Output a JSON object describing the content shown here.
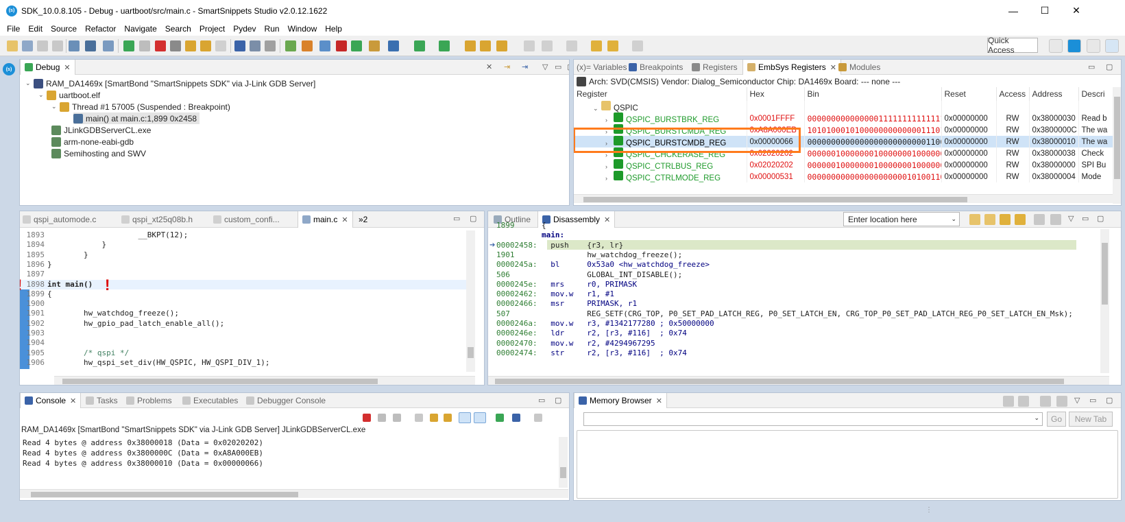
{
  "window": {
    "title": "SDK_10.0.8.105 - Debug - uartboot/src/main.c - SmartSnippets Studio v2.0.12.1622",
    "app_icon": "(s)",
    "minimize": "—",
    "maximize": "☐",
    "close": "✕"
  },
  "menu": [
    "File",
    "Edit",
    "Source",
    "Refactor",
    "Navigate",
    "Search",
    "Project",
    "Pydev",
    "Run",
    "Window",
    "Help"
  ],
  "toolbar": {
    "quick_access": "Quick Access"
  },
  "debug_view": {
    "tab": "Debug",
    "items": [
      {
        "label": "RAM_DA1469x [SmartBond \"SmartSnippets SDK\" via J-Link GDB Server]",
        "icon": "launch-icon",
        "depth": 0,
        "expanded": "⌄"
      },
      {
        "label": "uartboot.elf",
        "icon": "elf-icon",
        "depth": 1,
        "expanded": "⌄"
      },
      {
        "label": "Thread #1 57005 (Suspended : Breakpoint)",
        "icon": "thread-icon",
        "depth": 2,
        "expanded": "⌄"
      },
      {
        "label": "main() at main.c:1,899 0x2458",
        "icon": "stack-frame-icon",
        "depth": 3,
        "expanded": ""
      },
      {
        "label": "JLinkGDBServerCL.exe",
        "icon": "process-icon",
        "depth": 1,
        "expanded": ""
      },
      {
        "label": "arm-none-eabi-gdb",
        "icon": "process-icon",
        "depth": 1,
        "expanded": ""
      },
      {
        "label": "Semihosting and SWV",
        "icon": "process-icon",
        "depth": 1,
        "expanded": ""
      }
    ]
  },
  "registers_view": {
    "tabs": [
      {
        "label": "(x)= Variables",
        "active": false
      },
      {
        "label": "Breakpoints",
        "active": false
      },
      {
        "label": "Registers",
        "active": false
      },
      {
        "label": "EmbSys Registers",
        "active": true
      },
      {
        "label": "Modules",
        "active": false
      }
    ],
    "info": "Arch: SVD(CMSIS)  Vendor: Dialog_Semiconductor  Chip: DA1469x  Board: ---  none ---",
    "columns": [
      "Register",
      "Hex",
      "Bin",
      "Reset",
      "Access",
      "Address",
      "Descri"
    ],
    "group": "QSPIC",
    "rows": [
      {
        "name": "QSPIC_BURSTBRK_REG",
        "hex": "0x0001FFFF",
        "bin": "00000000000000011111111111111111",
        "reset": "0x00000000",
        "access": "RW",
        "address": "0x38000030",
        "desc": "Read b"
      },
      {
        "name": "QSPIC_BURSTCMDA_REG",
        "hex": "0xA8A000EB",
        "bin": "10101000101000000000000011101011",
        "reset": "0x00000000",
        "access": "RW",
        "address": "0x3800000C",
        "desc": "The wa"
      },
      {
        "name": "QSPIC_BURSTCMDB_REG",
        "hex": "0x00000066",
        "bin": "00000000000000000000000001100110",
        "reset": "0x00000000",
        "access": "RW",
        "address": "0x38000010",
        "desc": "The wa"
      },
      {
        "name": "QSPIC_CHCKERASE_REG",
        "hex": "0x02020202",
        "bin": "00000010000000100000001000000010",
        "reset": "0x00000000",
        "access": "RW",
        "address": "0x38000038",
        "desc": "Check"
      },
      {
        "name": "QSPIC_CTRLBUS_REG",
        "hex": "0x02020202",
        "bin": "00000010000000100000001000000010",
        "reset": "0x00000000",
        "access": "RW",
        "address": "0x38000000",
        "desc": "SPI Bu"
      },
      {
        "name": "QSPIC_CTRLMODE_REG",
        "hex": "0x00000531",
        "bin": "00000000000000000000010100110001",
        "reset": "0x00000000",
        "access": "RW",
        "address": "0x38000004",
        "desc": "Mode"
      }
    ],
    "colors": {
      "name": "#1d9a2a",
      "value": "#e01010",
      "highlight": "#ff7b1c",
      "selected": "#cfe3f7"
    }
  },
  "editor": {
    "tabs": [
      {
        "label": "qspi_automode.c",
        "active": false
      },
      {
        "label": "qspi_xt25q08b.h",
        "active": false
      },
      {
        "label": "custom_confi...",
        "active": false
      },
      {
        "label": "main.c",
        "active": true
      }
    ],
    "overflow": "»2",
    "lines": [
      {
        "n": "1893",
        "text": "                    __BKPT(12);"
      },
      {
        "n": "1894",
        "text": "            }"
      },
      {
        "n": "1895",
        "text": "        }"
      },
      {
        "n": "1896",
        "text": "}"
      },
      {
        "n": "1897",
        "text": ""
      },
      {
        "n": "1898",
        "text": "int main()"
      },
      {
        "n": "1899",
        "text": "{"
      },
      {
        "n": "1900",
        "text": ""
      },
      {
        "n": "1901",
        "text": "        hw_watchdog_freeze();"
      },
      {
        "n": "1902",
        "text": "        hw_gpio_pad_latch_enable_all();"
      },
      {
        "n": "1903",
        "text": ""
      },
      {
        "n": "1904",
        "text": ""
      },
      {
        "n": "1905",
        "text": "        /* qspi */"
      },
      {
        "n": "1906",
        "text": "        hw_qspi_set_div(HW_QSPIC, HW_QSPI_DIV_1);"
      }
    ],
    "markers": [
      "!",
      "!"
    ]
  },
  "disassembly": {
    "tabs": [
      {
        "label": "Outline",
        "active": false
      },
      {
        "label": "Disassembly",
        "active": true
      }
    ],
    "location_placeholder": "Enter location here",
    "lines": [
      {
        "addr": "1899",
        "text": "{"
      },
      {
        "addr": "",
        "text": "main:"
      },
      {
        "addr": "00002458:",
        "text": "  push    {r3, lr}"
      },
      {
        "addr": "1901",
        "text": "          hw_watchdog_freeze();"
      },
      {
        "addr": "0000245a:",
        "text": "  bl      0x53a0 <hw_watchdog_freeze>"
      },
      {
        "addr": "506",
        "text": "          GLOBAL_INT_DISABLE();"
      },
      {
        "addr": "0000245e:",
        "text": "  mrs     r0, PRIMASK"
      },
      {
        "addr": "00002462:",
        "text": "  mov.w   r1, #1"
      },
      {
        "addr": "00002466:",
        "text": "  msr     PRIMASK, r1"
      },
      {
        "addr": "507",
        "text": "          REG_SETF(CRG_TOP, P0_SET_PAD_LATCH_REG, P0_SET_LATCH_EN, CRG_TOP_P0_SET_PAD_LATCH_REG_P0_SET_LATCH_EN_Msk);"
      },
      {
        "addr": "0000246a:",
        "text": "  mov.w   r3, #1342177280 ; 0x50000000"
      },
      {
        "addr": "0000246e:",
        "text": "  ldr     r2, [r3, #116]  ; 0x74"
      },
      {
        "addr": "00002470:",
        "text": "  mov.w   r2, #4294967295"
      },
      {
        "addr": "00002474:",
        "text": "  str     r2, [r3, #116]  ; 0x74"
      }
    ]
  },
  "console": {
    "tabs": [
      {
        "label": "Console",
        "active": true
      },
      {
        "label": "Tasks",
        "active": false
      },
      {
        "label": "Problems",
        "active": false
      },
      {
        "label": "Executables",
        "active": false
      },
      {
        "label": "Debugger Console",
        "active": false
      }
    ],
    "header": "RAM_DA1469x [SmartBond \"SmartSnippets SDK\" via J-Link GDB Server] JLinkGDBServerCL.exe",
    "lines": [
      "Read 4 bytes @ address 0x38000018 (Data = 0x02020202)",
      "Read 4 bytes @ address 0x3800000C (Data = 0xA8A000EB)",
      "Read 4 bytes @ address 0x38000010 (Data = 0x00000066)"
    ]
  },
  "memory": {
    "tab": "Memory Browser",
    "go": "Go",
    "new_tab": "New Tab"
  }
}
